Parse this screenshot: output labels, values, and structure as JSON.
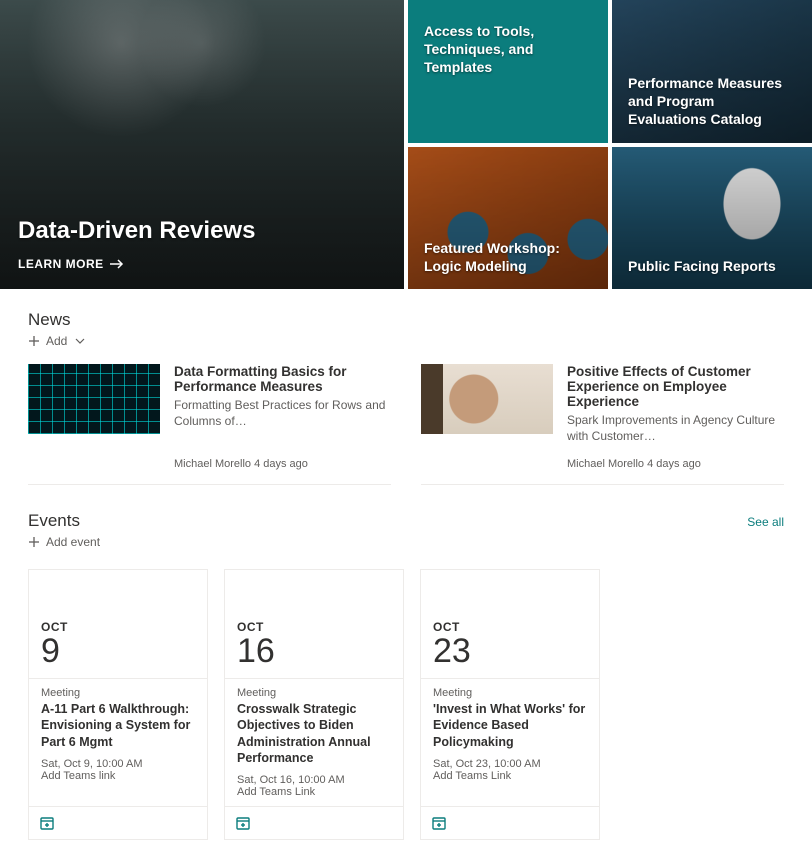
{
  "hero": {
    "main_title": "Data-Driven Reviews",
    "learn_more": "LEARN MORE",
    "tiles": [
      {
        "label": "Access to Tools, Techniques, and Templates"
      },
      {
        "label": "Performance Measures and Program Evaluations Catalog"
      },
      {
        "label": "Featured Workshop: Logic Modeling"
      },
      {
        "label": "Public Facing Reports"
      }
    ]
  },
  "news": {
    "heading": "News",
    "add_label": "Add",
    "items": [
      {
        "title": "Data Formatting Basics for Performance Measures",
        "desc": "Formatting Best Practices for Rows and Columns of…",
        "author": "Michael Morello",
        "age": "4 days ago"
      },
      {
        "title": "Positive Effects of Customer Experience on Employee Experience",
        "desc": "Spark Improvements in Agency Culture with Customer…",
        "author": "Michael Morello",
        "age": "4 days ago"
      }
    ]
  },
  "events": {
    "heading": "Events",
    "add_label": "Add event",
    "see_all": "See all",
    "items": [
      {
        "month": "OCT",
        "day": "9",
        "kind": "Meeting",
        "title": "A-11 Part 6 Walkthrough: Envisioning a System for Part 6 Mgmt",
        "time": "Sat, Oct 9, 10:00 AM",
        "teams": "Add Teams link"
      },
      {
        "month": "OCT",
        "day": "16",
        "kind": "Meeting",
        "title": "Crosswalk Strategic Objectives to Biden Administration Annual Performance",
        "time": "Sat, Oct 16, 10:00 AM",
        "teams": "Add Teams Link"
      },
      {
        "month": "OCT",
        "day": "23",
        "kind": "Meeting",
        "title": "'Invest in What Works' for Evidence Based Policymaking",
        "time": "Sat, Oct 23, 10:00 AM",
        "teams": "Add Teams Link"
      }
    ]
  }
}
